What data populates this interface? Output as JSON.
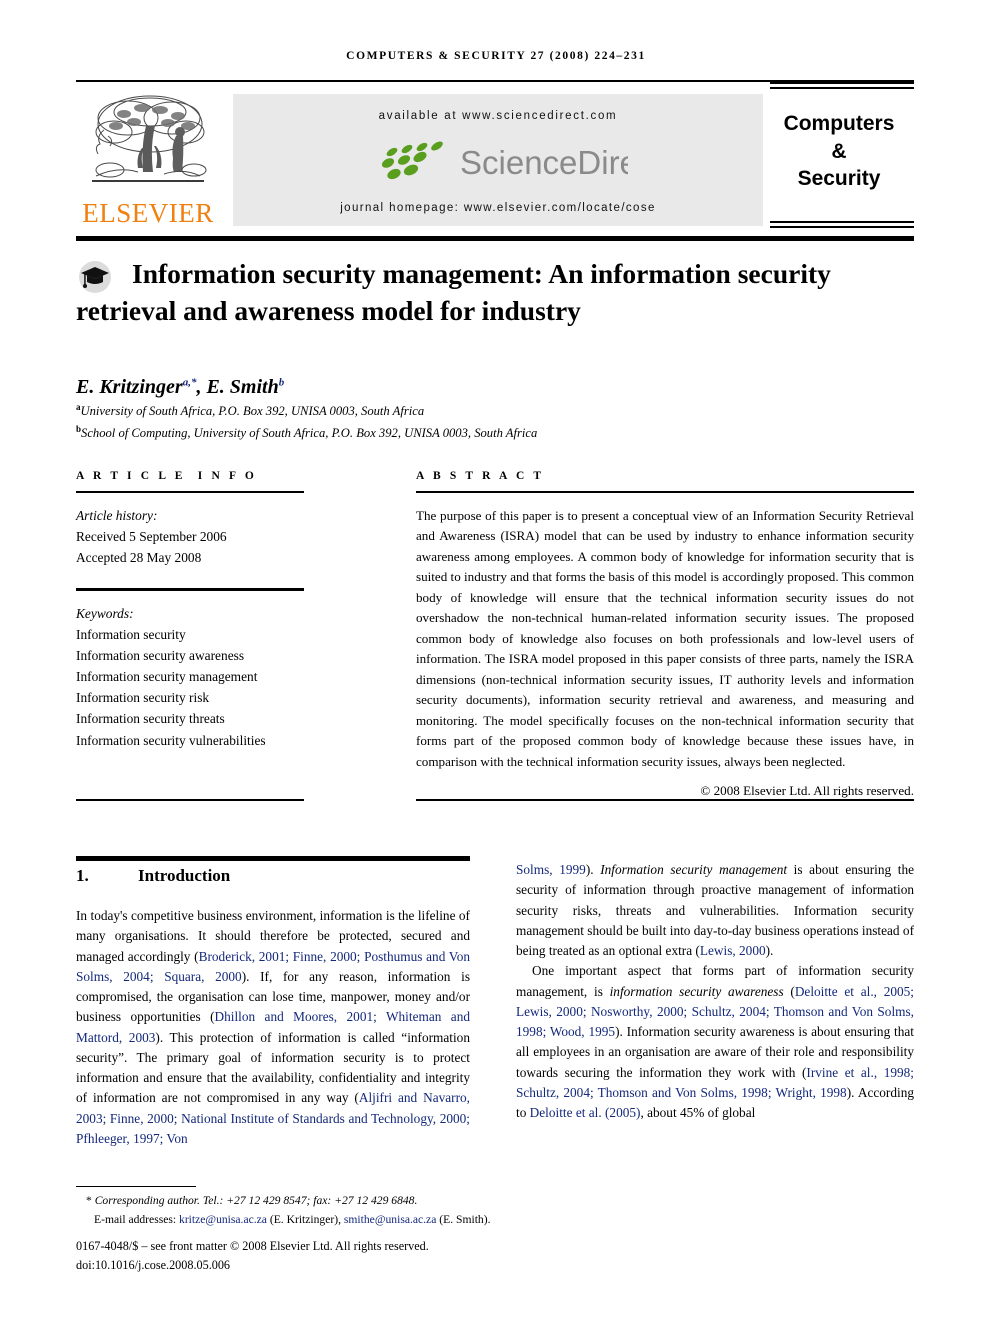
{
  "running_head": "Computers & security 27 (2008) 224–231",
  "masthead": {
    "publisher_name": "ELSEVIER",
    "publisher_logo_icon": "elsevier-tree-logo",
    "available_at": "available at www.sciencedirect.com",
    "sciencedirect_wordmark": "ScienceDirect",
    "sciencedirect_logo_icon": "sciencedirect-leaves-icon",
    "journal_homepage": "journal homepage: www.elsevier.com/locate/cose",
    "journal_name_lines": [
      "Computers",
      "&",
      "Security"
    ],
    "brand_colors": {
      "elsevier_orange": "#f08010",
      "sciencedirect_green": "#5a9e20",
      "banner_grey": "#e9e9e9",
      "citation_blue": "#13287a"
    }
  },
  "article": {
    "title_icon": "graduation-cap-icon",
    "title": "Information security management: An information security retrieval and awareness model for industry",
    "authors": "E. Kritzinger, E. Smith",
    "author_marks": {
      "first": "a,*",
      "second": "b"
    },
    "affiliations": [
      {
        "mark": "a",
        "text": "University of South Africa, P.O. Box 392, UNISA 0003, South Africa"
      },
      {
        "mark": "b",
        "text": "School of Computing, University of South Africa, P.O. Box 392, UNISA 0003, South Africa"
      }
    ]
  },
  "article_info": {
    "heading": "ARTICLE INFO",
    "history_label": "Article history:",
    "history": [
      "Received 5 September 2006",
      "Accepted 28 May 2008"
    ],
    "keywords_label": "Keywords:",
    "keywords": [
      "Information security",
      "Information security awareness",
      "Information security management",
      "Information security risk",
      "Information security threats",
      "Information security vulnerabilities"
    ]
  },
  "abstract": {
    "heading": "ABSTRACT",
    "text": "The purpose of this paper is to present a conceptual view of an Information Security Retrieval and Awareness (ISRA) model that can be used by industry to enhance information security awareness among employees. A common body of knowledge for information security that is suited to industry and that forms the basis of this model is accordingly proposed. This common body of knowledge will ensure that the technical information security issues do not overshadow the non-technical human-related information security issues. The proposed common body of knowledge also focuses on both professionals and low-level users of information. The ISRA model proposed in this paper consists of three parts, namely the ISRA dimensions (non-technical information security issues, IT authority levels and information security documents), information security retrieval and awareness, and measuring and monitoring. The model specifically focuses on the non-technical information security that forms part of the proposed common body of knowledge because these issues have, in comparison with the technical information security issues, always been neglected.",
    "copyright": "© 2008 Elsevier Ltd. All rights reserved."
  },
  "body": {
    "section_number": "1.",
    "section_title": "Introduction",
    "left_column_html": "In today's competitive business environment, information is the lifeline of many organisations. It should therefore be protected, secured and managed accordingly (<span class=\"cite\">Broderick, 2001; Finne, 2000; Posthumus and Von Solms, 2004; Squara, 2000</span>). If, for any reason, information is compromised, the organisation can lose time, manpower, money and/or business opportunities (<span class=\"cite\">Dhillon and Moores, 2001; Whiteman and Mattord, 2003</span>). This protection of information is called &ldquo;information security&rdquo;. The primary goal of information security is to protect information and ensure that the availability, confidentiality and integrity of information are not compromised in any way (<span class=\"cite\">Aljifri and Navarro, 2003; Finne, 2000; National Institute of Standards and Technology, 2000; Pfhleeger, 1997; Von</span>",
    "right_column_html_1": "<span class=\"cite\">Solms, 1999</span>). <span class=\"italic\">Information security management</span> is about ensuring the security of information through proactive management of information security risks, threats and vulnerabilities. Information security management should be built into day-to-day business operations instead of being treated as an optional extra (<span class=\"cite\">Lewis, 2000</span>).",
    "right_column_html_2": "One important aspect that forms part of information security management, is <span class=\"italic\">information security awareness</span> (<span class=\"cite\">Deloitte et al., 2005; Lewis, 2000; Nosworthy, 2000; Schultz, 2004; Thomson and Von Solms, 1998; Wood, 1995</span>). Information security awareness is about ensuring that all employees in an organisation are aware of their role and responsibility towards securing the information they work with (<span class=\"cite\">Irvine et al., 1998; Schultz, 2004; Thomson and Von Solms, 1998; Wright, 1998</span>). According to <span class=\"cite\">Deloitte et al. (2005)</span>, about 45% of global"
  },
  "footnotes": {
    "corresponding": "Corresponding author. Tel.: +27 12 429 8547; fax: +27 12 429 6848.",
    "corresponding_mark": "*",
    "email_label": "E-mail addresses:",
    "emails": [
      {
        "address": "kritze@unisa.ac.za",
        "person": "(E. Kritzinger)"
      },
      {
        "address": "smithe@unisa.ac.za",
        "person": "(E. Smith)"
      }
    ],
    "issn_line": "0167-4048/$ – see front matter © 2008 Elsevier Ltd. All rights reserved.",
    "doi_line": "doi:10.1016/j.cose.2008.05.006"
  }
}
